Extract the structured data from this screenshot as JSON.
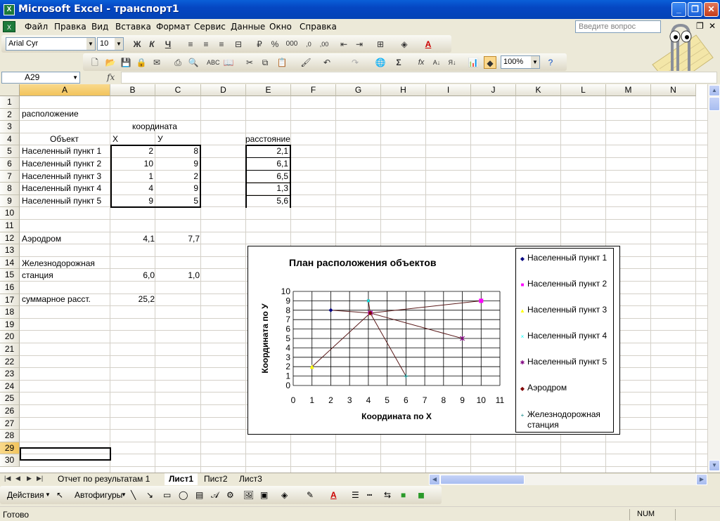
{
  "window": {
    "title": "Microsoft Excel - транспорт1"
  },
  "menu": {
    "items": [
      "Файл",
      "Правка",
      "Вид",
      "Вставка",
      "Формат",
      "Сервис",
      "Данные",
      "Окно",
      "Справка"
    ],
    "help_placeholder": "Введите вопрос"
  },
  "format_toolbar": {
    "font": "Arial Cyr",
    "size": "10",
    "bold": "Ж",
    "italic": "К",
    "underline": "Ч",
    "percent": "%",
    "thousands": "000"
  },
  "standard_toolbar": {
    "zoom": "100%",
    "sum": "Σ",
    "fx": "fx"
  },
  "formula_bar": {
    "name_box": "A29",
    "fx_label": "fx",
    "formula": ""
  },
  "columns": [
    "A",
    "B",
    "C",
    "D",
    "E",
    "F",
    "G",
    "H",
    "I",
    "J",
    "K",
    "L",
    "M",
    "N"
  ],
  "rows": [
    "1",
    "2",
    "3",
    "4",
    "5",
    "6",
    "7",
    "8",
    "9",
    "10",
    "11",
    "12",
    "13",
    "14",
    "15",
    "16",
    "17",
    "18",
    "19",
    "20",
    "21",
    "22",
    "23",
    "24",
    "25",
    "26",
    "27",
    "28",
    "29",
    "30"
  ],
  "active_cell": "A29",
  "cells": {
    "a2": "расположение",
    "b3": "координата",
    "a4": "Объект",
    "b4": "Х",
    "c4": "У",
    "e4": "расстояние",
    "settlements": [
      {
        "name": "Населенный пункт 1",
        "x": "2",
        "y": "8",
        "dist": "2,1"
      },
      {
        "name": "Населенный пункт 2",
        "x": "10",
        "y": "9",
        "dist": "6,1"
      },
      {
        "name": "Населенный пункт 3",
        "x": "1",
        "y": "2",
        "dist": "6,5"
      },
      {
        "name": "Населенный пункт 4",
        "x": "4",
        "y": "9",
        "dist": "1,3"
      },
      {
        "name": "Населенный пункт 5",
        "x": "9",
        "y": "5",
        "dist": "5,6"
      }
    ],
    "a12": "Аэродром",
    "b12": "4,1",
    "c12": "7,7",
    "a13": "Железнодорожная",
    "a14": "станция",
    "b14": "6,0",
    "c14": "1,0",
    "a16": "суммарное расст.",
    "b16": "25,2"
  },
  "chart_data": {
    "type": "scatter",
    "title": "План расположения объектов",
    "xlabel": "Координата по Х",
    "ylabel": "Координата по У",
    "xlim": [
      0,
      11
    ],
    "ylim": [
      0,
      10
    ],
    "xticks": [
      "0",
      "1",
      "2",
      "3",
      "4",
      "5",
      "6",
      "7",
      "8",
      "9",
      "10",
      "11"
    ],
    "yticks": [
      "0",
      "1",
      "2",
      "3",
      "4",
      "5",
      "6",
      "7",
      "8",
      "9",
      "10"
    ],
    "grid": true,
    "legend_position": "right",
    "series": [
      {
        "name": "Населенный пункт 1",
        "points": [
          [
            2,
            8
          ],
          [
            4.1,
            7.7
          ]
        ],
        "color": "#000080",
        "marker": "diamond"
      },
      {
        "name": "Населенный пункт 2",
        "points": [
          [
            10,
            9
          ],
          [
            4.1,
            7.7
          ]
        ],
        "color": "#ff00ff",
        "marker": "square"
      },
      {
        "name": "Населенный пункт 3",
        "points": [
          [
            1,
            2
          ],
          [
            4.1,
            7.7
          ]
        ],
        "color": "#ffff00",
        "marker": "triangle"
      },
      {
        "name": "Населенный пункт 4",
        "points": [
          [
            4,
            9
          ],
          [
            4.1,
            7.7
          ]
        ],
        "color": "#00ffff",
        "marker": "x"
      },
      {
        "name": "Населенный пункт 5",
        "points": [
          [
            9,
            5
          ],
          [
            4.1,
            7.7
          ]
        ],
        "color": "#800080",
        "marker": "star"
      },
      {
        "name": "Аэродром",
        "points": [
          [
            4.1,
            7.7
          ]
        ],
        "color": "#800000",
        "marker": "diamond"
      },
      {
        "name": "Железнодорожная станция",
        "points": [
          [
            6,
            1
          ]
        ],
        "color": "#008080",
        "marker": "plus"
      }
    ],
    "links": [
      [
        2,
        8,
        4.1,
        7.7
      ],
      [
        10,
        9,
        4.1,
        7.7
      ],
      [
        1,
        2,
        4.1,
        7.7
      ],
      [
        4,
        9,
        4.1,
        7.7
      ],
      [
        9,
        5,
        4.1,
        7.7
      ],
      [
        6,
        1,
        4.1,
        7.7
      ]
    ],
    "legend_lines": [
      "Населенный пункт 1",
      "Населенный пункт 2",
      "Населенный пункт 3",
      "Населенный пункт 4",
      "Населенный пункт 5",
      "Аэродром",
      "Железнодорожная",
      "станция"
    ]
  },
  "sheets": {
    "tabs": [
      "Отчет по результатам 1",
      "Лист1",
      "Пист2",
      "Лист3"
    ],
    "active": "Лист1"
  },
  "draw_toolbar": {
    "actions": "Действия",
    "autoshapes": "Автофигуры"
  },
  "status": {
    "text": "Готово",
    "num": "NUM"
  }
}
